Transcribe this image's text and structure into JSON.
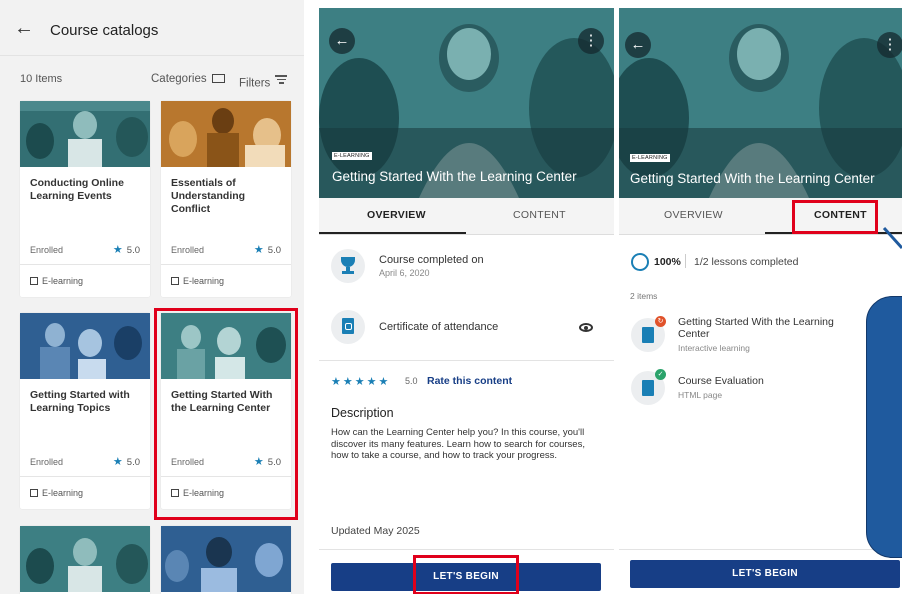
{
  "catalog": {
    "title": "Course catalogs",
    "items_count": "10 Items",
    "categories_label": "Categories",
    "filters_label": "Filters",
    "cards": [
      {
        "title": "Conducting Online Learning Events",
        "status": "Enrolled",
        "rating": "5.0",
        "type": "E-learning"
      },
      {
        "title": "Essentials of Understanding Conflict",
        "status": "Enrolled",
        "rating": "5.0",
        "type": "E-learning"
      },
      {
        "title": "Getting Started with Learning Topics",
        "status": "Enrolled",
        "rating": "5.0",
        "type": "E-learning"
      },
      {
        "title": "Getting Started With the Learning Center",
        "status": "Enrolled",
        "rating": "5.0",
        "type": "E-learning"
      }
    ]
  },
  "course": {
    "tag": "E-LEARNING",
    "title": "Getting Started With the Learning Center",
    "tabs": {
      "overview": "OVERVIEW",
      "content": "CONTENT"
    },
    "completed_label": "Course completed on",
    "completed_date": "April 6, 2020",
    "certificate_label": "Certificate of attendance",
    "rating_value": "5.0",
    "rate_link": "Rate this content",
    "description_heading": "Description",
    "description_text": "How can the Learning Center help you? In this course, you'll discover its many features. Learn how to search for courses, how to take a course, and how to track your progress.",
    "updated": "Updated May 2025",
    "begin_label": "LET'S BEGIN"
  },
  "content": {
    "progress_percent": "100%",
    "progress_value": 1.0,
    "lessons_completed": "1/2 lessons completed",
    "items_count": "2 items",
    "lessons": [
      {
        "title": "Getting Started With the Learning Center",
        "type": "Interactive learning"
      },
      {
        "title": "Course Evaluation",
        "type": "HTML page"
      }
    ]
  },
  "colors": {
    "accent": "#1a7fb5",
    "primary_button": "#173e86",
    "highlight": "#e0001b",
    "teal_image": "#3d7f83",
    "orange_image": "#b8772e",
    "blue_image": "#2f5f92"
  },
  "icons": [
    "back-arrow-icon",
    "folder-icon",
    "filter-icon",
    "star-icon",
    "elearning-icon",
    "more-vert-icon",
    "trophy-icon",
    "pdf-icon",
    "eye-icon",
    "lesson-doc-icon",
    "check-badge-icon"
  ]
}
